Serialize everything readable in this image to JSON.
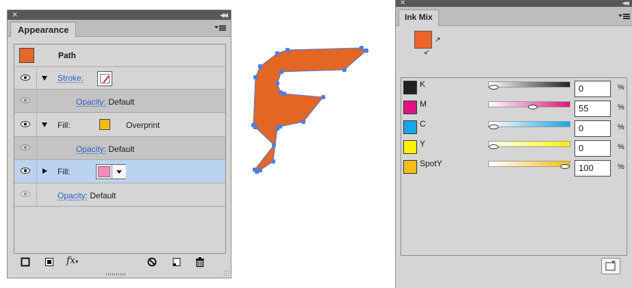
{
  "appearance": {
    "tab_label": "Appearance",
    "object_label": "Path",
    "object_color": "#e6672a",
    "rows": [
      {
        "name_label": "Stroke:"
      },
      {
        "opacity_label": "Opacity:",
        "opacity_value": "Default"
      },
      {
        "name_label": "Fill:",
        "swatch_color": "#f6b80c",
        "extra_label": "Overprint"
      },
      {
        "opacity_label": "Opacity:",
        "opacity_value": "Default"
      },
      {
        "name_label": "Fill:",
        "swatch_color": "#f18bba"
      },
      {
        "opacity_label": "Opacity:",
        "opacity_value": "Default"
      }
    ],
    "fx_label": "fx"
  },
  "shape": {
    "fill_color": "#e26624",
    "anchor_color": "#4a7fe8"
  },
  "inkmix": {
    "tab_label": "Ink Mix",
    "current_color": "#f0622a",
    "inks": [
      {
        "name": "K",
        "value": "0",
        "unit": "%",
        "color": "#222222",
        "level": 0
      },
      {
        "name": "M",
        "value": "55",
        "unit": "%",
        "color": "#e0137e",
        "level": 55
      },
      {
        "name": "C",
        "value": "0",
        "unit": "%",
        "color": "#19a6e6",
        "level": 0
      },
      {
        "name": "Y",
        "value": "0",
        "unit": "%",
        "color": "#fff200",
        "level": 0
      },
      {
        "name": "SpotY",
        "value": "100",
        "unit": "%",
        "color": "#f7bd13",
        "level": 100
      }
    ]
  }
}
